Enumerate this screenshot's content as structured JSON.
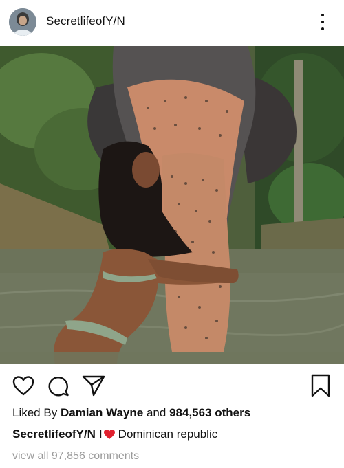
{
  "header": {
    "username": "SecretlifeofY/N",
    "avatar_icon": "profile-avatar",
    "more_icon": "more-vertical-icon"
  },
  "photo": {
    "subject": "woman hugging elephant trunk in river"
  },
  "actions": {
    "like_icon": "heart-outline-icon",
    "comment_icon": "speech-bubble-icon",
    "share_icon": "paper-plane-icon",
    "save_icon": "bookmark-icon"
  },
  "likes": {
    "prefix": "Liked By",
    "user": "Damian Wayne",
    "conjunction": "and",
    "count": "984,563 others"
  },
  "caption": {
    "username": "SecretlifeofY/N",
    "text_before": "I",
    "emoji": "red-heart-emoji",
    "text_after": "Dominican republic"
  },
  "comments": {
    "view_all": "view all 97,856 comments"
  },
  "colors": {
    "text": "#111111",
    "muted": "#9a9a9a",
    "heart_emoji": "#e0202e",
    "background": "#ffffff"
  }
}
